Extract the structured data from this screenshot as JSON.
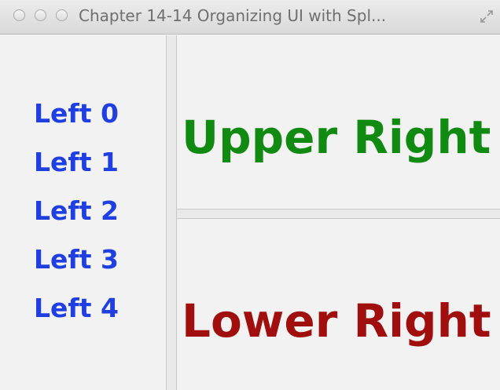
{
  "window": {
    "title": "Chapter 14-14 Organizing UI with Spl...",
    "controls": {
      "close": "close-button",
      "minimize": "minimize-button",
      "zoom": "zoom-button",
      "fullscreen_icon": "fullscreen-icon"
    }
  },
  "left_pane": {
    "labels": [
      "Left 0",
      "Left 1",
      "Left 2",
      "Left 3",
      "Left 4"
    ]
  },
  "upper_right": {
    "label": "Upper Right"
  },
  "lower_right": {
    "label": "Lower Right"
  },
  "colors": {
    "left_text": "#1f3fe0",
    "upper_text": "#118a11",
    "lower_text": "#a00e0e",
    "background": "#f2f2f2"
  }
}
